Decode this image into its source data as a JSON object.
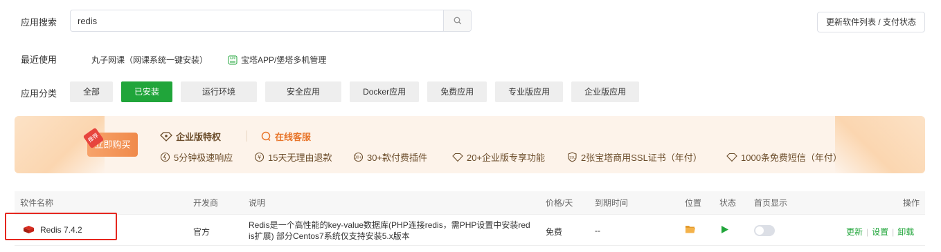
{
  "search": {
    "label": "应用搜索",
    "value": "redis",
    "refresh_button": "更新软件列表 / 支付状态"
  },
  "recent": {
    "label": "最近使用",
    "items": [
      "丸子网课（网课系统一键安装）",
      "宝塔APP/堡塔多机管理"
    ]
  },
  "category": {
    "label": "应用分类",
    "items": [
      "全部",
      "已安装",
      "运行环境",
      "安全应用",
      "Docker应用",
      "免费应用",
      "专业版应用",
      "企业版应用"
    ],
    "active": "已安装"
  },
  "promo": {
    "badge": "推荐",
    "buy_button": "立即购买",
    "title": "企业版特权",
    "service": "在线客服",
    "features": [
      "5分钟极速响应",
      "15天无理由退款",
      "30+款付费插件",
      "20+企业版专享功能",
      "2张宝塔商用SSL证书（年付）",
      "1000条免费短信（年付）"
    ]
  },
  "table": {
    "headers": {
      "name": "软件名称",
      "developer": "开发商",
      "description": "说明",
      "price": "价格/天",
      "expiry": "到期时间",
      "location": "位置",
      "status": "状态",
      "homepage": "首页显示",
      "actions": "操作"
    },
    "rows": [
      {
        "name": "Redis 7.4.2",
        "developer": "官方",
        "description_line1": "Redis是一个高性能的key-value数据库(PHP连接redis，需PHP设置中安装red",
        "description_line2": "is扩展) 部分Centos7系统仅支持安装5.x版本",
        "price": "免费",
        "expiry": "--",
        "actions": [
          "更新",
          "设置",
          "卸载"
        ]
      }
    ]
  },
  "colors": {
    "accent": "#20a53a",
    "highlight_box": "#e5261e",
    "promo_bg": "#fdf3ea",
    "promo_btn": "#f08a4b",
    "folder": "#f0a030"
  }
}
